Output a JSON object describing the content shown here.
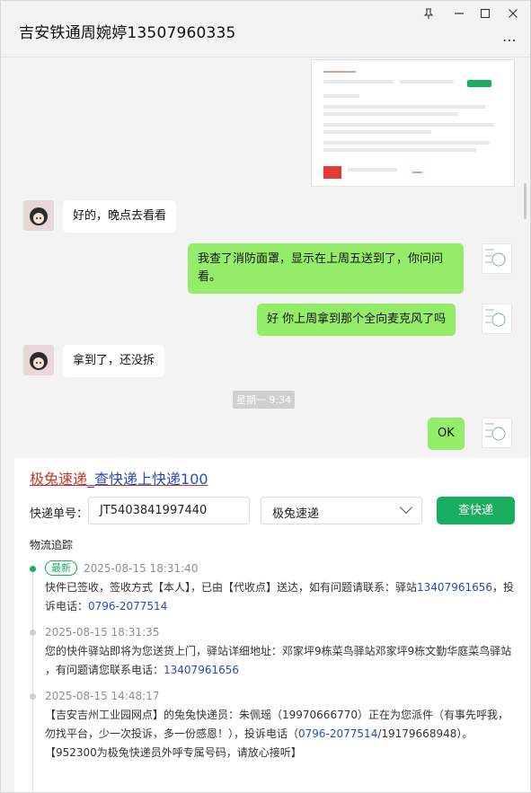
{
  "title": "吉安铁通周婉婷13507960335",
  "window_controls": {
    "pin": "⌖",
    "minimize": "–",
    "maximize": "□",
    "close": "✕",
    "more": "⋯"
  },
  "chat": {
    "messages": [
      {
        "side": "in",
        "text": "好的，晚点去看看"
      },
      {
        "side": "out",
        "text": "我查了消防面罩，显示在上周五送到了，你问问看。"
      },
      {
        "side": "out",
        "text": "好 你上周拿到那个全向麦克风了吗"
      },
      {
        "side": "in",
        "text": "拿到了，还没拆"
      },
      {
        "side": "out",
        "text": "OK"
      }
    ],
    "timestamp": "星期一 9:34"
  },
  "express": {
    "brand_part1": "极兔速递",
    "brand_part2": "_查快递上快递100",
    "label_number": "快递单号：",
    "tracking_number": "JT5403841997440",
    "courier": "极兔速递",
    "query_button": "查快递",
    "tracking_title": "物流追踪",
    "badge_latest": "最新",
    "events": [
      {
        "time": "2025-08-15 18:31:40",
        "text_a": "快件已签收，签收方式【本人】，已由【代收点】送达，如有问题请联系：驿站",
        "phone_a": "13407961656",
        "text_b": "，投诉电话：",
        "phone_b": "0796-2077514"
      },
      {
        "time": "2025-08-15 18:31:35",
        "text_a": "您的快件驿站即将为您送货上门，驿站详细地址：邓家坪9栋菜鸟驿站邓家坪9栋文勤华庭菜鸟驿站 ，有问题请您联系电话：",
        "phone_a": "13407961656"
      },
      {
        "time": "2025-08-15 14:48:17",
        "text_a": "【吉安吉州工业园网点】的兔兔快递员：朱佩瑶（19970666770）正在为您派件（有事先呼我，勿找平台，少一次投诉，多一份感恩！），投诉电话（",
        "phone_a": "0796-2077514",
        "text_b": "/19179668948）。【952300为极兔快递员外呼专属号码，请放心接听】"
      }
    ]
  }
}
